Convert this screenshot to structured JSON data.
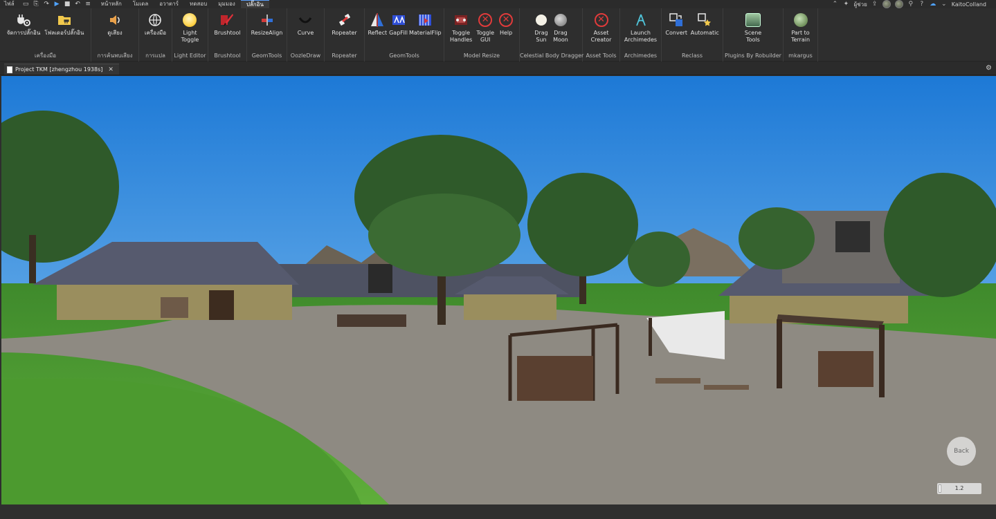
{
  "menubar": {
    "file_label": "ไฟล์",
    "tabs": [
      {
        "label": "หน้าหลัก",
        "active": false
      },
      {
        "label": "โมเดล",
        "active": false
      },
      {
        "label": "อวาตาร์",
        "active": false
      },
      {
        "label": "ทดสอบ",
        "active": false
      },
      {
        "label": "มุมมอง",
        "active": false
      },
      {
        "label": "ปลั๊กอิน",
        "active": true
      }
    ],
    "help_label": "ผู้ช่วย",
    "username": "KaitoColland",
    "accent": "#5aa0ff"
  },
  "ribbon": {
    "groups": [
      {
        "label": "เครื่องมือ",
        "buttons": [
          {
            "label": "จัดการปลั๊กอิน",
            "icon": "plugin-gear-icon"
          },
          {
            "label": "โฟลเดอร์ปลั๊กอิน",
            "icon": "plugin-folder-icon"
          }
        ]
      },
      {
        "label": "การค้นพบเสียง",
        "buttons": [
          {
            "label": "ดูเสียง",
            "icon": "speaker-icon"
          }
        ]
      },
      {
        "label": "การแปล",
        "buttons": [
          {
            "label": "เครื่องมือ",
            "icon": "translate-icon"
          }
        ]
      },
      {
        "label": "Light Editor",
        "buttons": [
          {
            "label": "Light\nToggle",
            "icon": "light-bulb-icon"
          }
        ]
      },
      {
        "label": "Brushtool",
        "buttons": [
          {
            "label": "Brushtool",
            "icon": "brush-icon"
          }
        ]
      },
      {
        "label": "GeomTools",
        "buttons": [
          {
            "label": "ResizeAlign",
            "icon": "resize-align-icon"
          }
        ]
      },
      {
        "label": "OozleDraw",
        "buttons": [
          {
            "label": "Curve",
            "icon": "curve-icon"
          }
        ]
      },
      {
        "label": "Ropeater",
        "buttons": [
          {
            "label": "Ropeater",
            "icon": "ropeater-icon"
          }
        ]
      },
      {
        "label": "GeomTools",
        "buttons": [
          {
            "label": "Reflect",
            "icon": "reflect-icon"
          },
          {
            "label": "GapFill",
            "icon": "gapfill-icon"
          },
          {
            "label": "MaterialFlip",
            "icon": "material-flip-icon"
          }
        ]
      },
      {
        "label": "Model Resize",
        "buttons": [
          {
            "label": "Toggle\nHandles",
            "icon": "toggle-handles-icon"
          },
          {
            "label": "Toggle\nGUI",
            "icon": "red-x-icon"
          },
          {
            "label": "Help",
            "icon": "red-x-icon"
          }
        ]
      },
      {
        "label": "Celestial Body Dragger",
        "buttons": [
          {
            "label": "Drag\nSun",
            "icon": "sun-icon"
          },
          {
            "label": "Drag\nMoon",
            "icon": "moon-icon"
          }
        ]
      },
      {
        "label": "Asset Tools",
        "buttons": [
          {
            "label": "Asset\nCreator",
            "icon": "red-x-icon"
          }
        ]
      },
      {
        "label": "Archimedes",
        "buttons": [
          {
            "label": "Launch\nArchimedes",
            "icon": "archimedes-icon"
          }
        ]
      },
      {
        "label": "Reclass",
        "buttons": [
          {
            "label": "Convert",
            "icon": "convert-icon"
          },
          {
            "label": "Automatic",
            "icon": "automatic-icon"
          }
        ]
      },
      {
        "label": "Plugins By Robuilder",
        "buttons": [
          {
            "label": "Scene\nTools",
            "icon": "scene-tools-icon"
          }
        ]
      },
      {
        "label": "mkargus",
        "buttons": [
          {
            "label": "Part to\nTerrain",
            "icon": "part-to-terrain-icon"
          }
        ]
      }
    ]
  },
  "document_tab": {
    "title": "Project TKM [zhengzhou 1938s]"
  },
  "viewport": {
    "back_label": "Back",
    "zoom_value": "1.2"
  }
}
